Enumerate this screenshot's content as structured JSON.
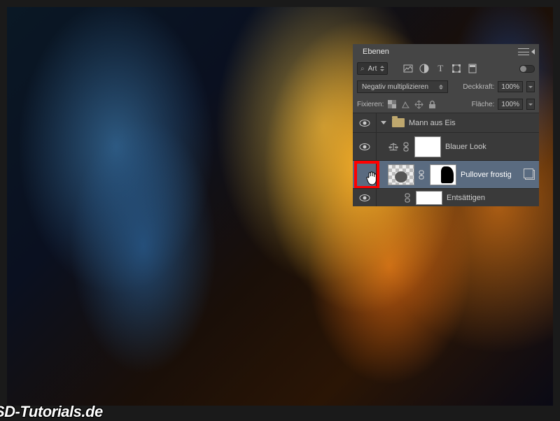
{
  "panel": {
    "title": "Ebenen",
    "filter": {
      "label": "Art"
    },
    "blend_mode": "Negativ multiplizieren",
    "opacity": {
      "label": "Deckkraft:",
      "value": "100%"
    },
    "fill": {
      "label": "Fläche:",
      "value": "100%"
    },
    "lock_label": "Fixieren:"
  },
  "layers": {
    "group": {
      "name": "Mann aus Eis"
    },
    "layer1": {
      "name": "Blauer Look"
    },
    "layer2": {
      "name": "Pullover frostig"
    },
    "layer3": {
      "name": "Entsättigen"
    }
  },
  "watermark": "SD-Tutorials.de"
}
